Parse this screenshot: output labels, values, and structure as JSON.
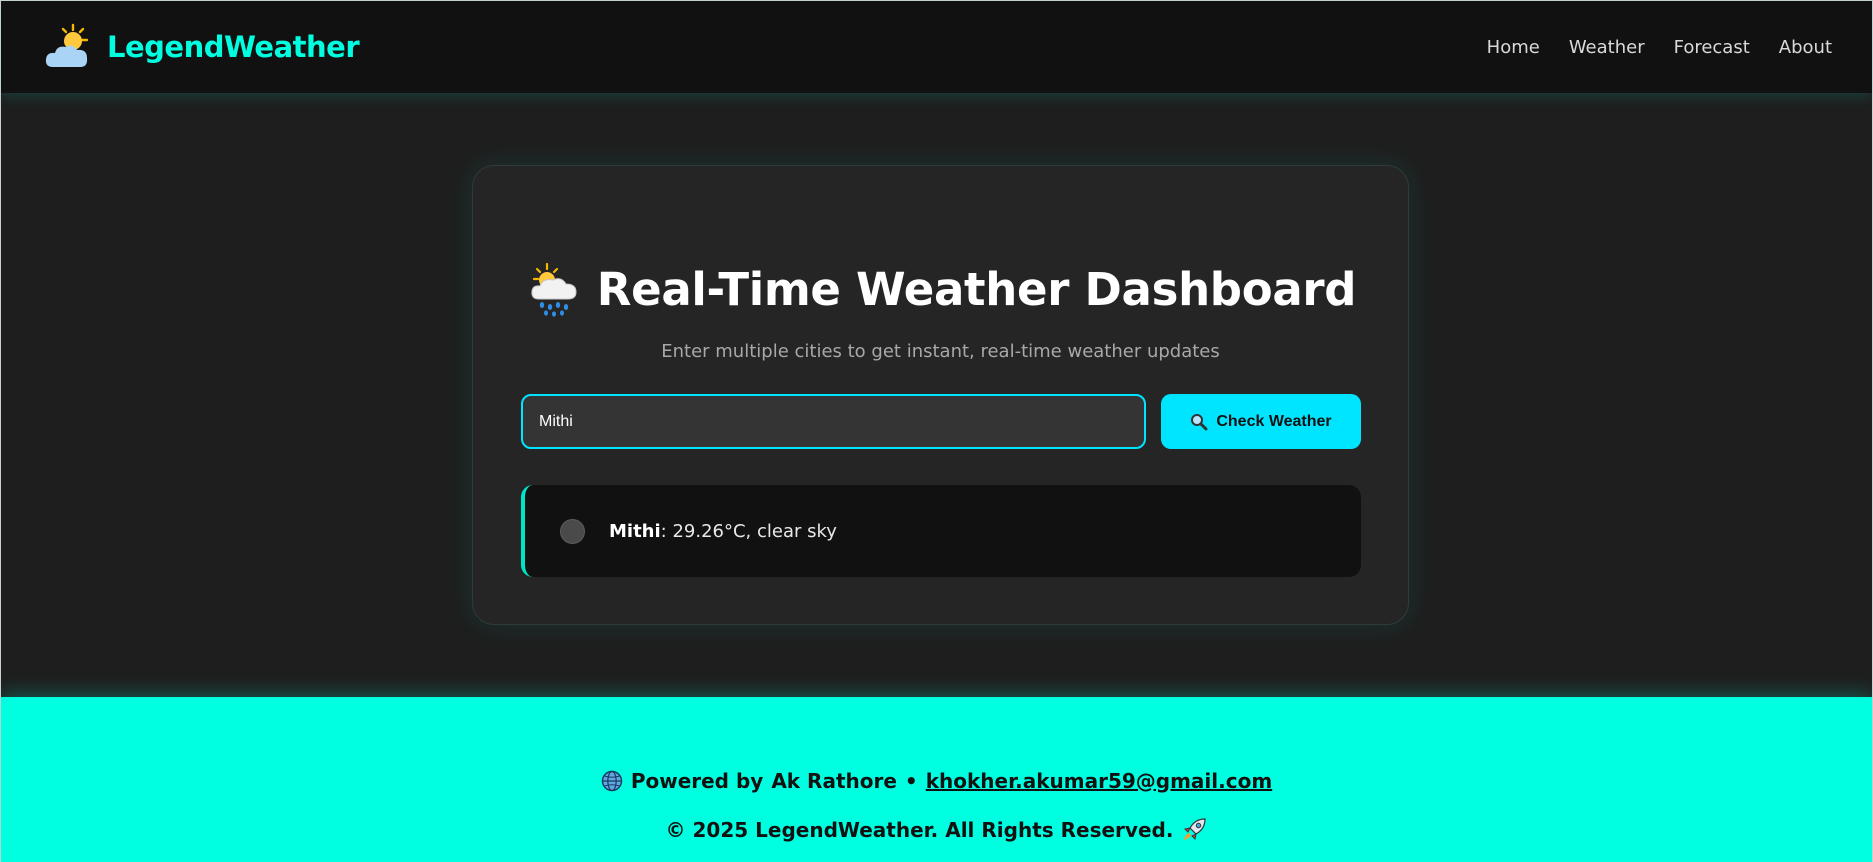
{
  "header": {
    "brand": "LegendWeather",
    "brand_icon": "sun-behind-cloud-icon",
    "nav": [
      "Home",
      "Weather",
      "Forecast",
      "About"
    ]
  },
  "card": {
    "title_icon": "cloud-with-sun-and-rain-icon",
    "title": "Real-Time Weather Dashboard",
    "subtitle": "Enter multiple cities to get instant, real-time weather updates",
    "input_value": "Mithi",
    "button_icon": "magnifying-glass-icon",
    "button_label": "Check Weather",
    "result": {
      "status_icon": "gray-circle-icon",
      "city": "Mithi",
      "details": ": 29.26°C, clear sky"
    }
  },
  "footer": {
    "globe_icon": "globe-icon",
    "powered_prefix": "Powered by",
    "author": "Ak Rathore",
    "separator": "•",
    "email": "khokher.akumar59@gmail.com",
    "copyright": "© 2025 LegendWeather. All Rights Reserved.",
    "rocket_icon": "rocket-icon"
  },
  "colors": {
    "accent": "#00ffe0",
    "button": "#00e5ff",
    "background": "#1e1e1e",
    "navbar": "#111111",
    "card": "#252525"
  }
}
